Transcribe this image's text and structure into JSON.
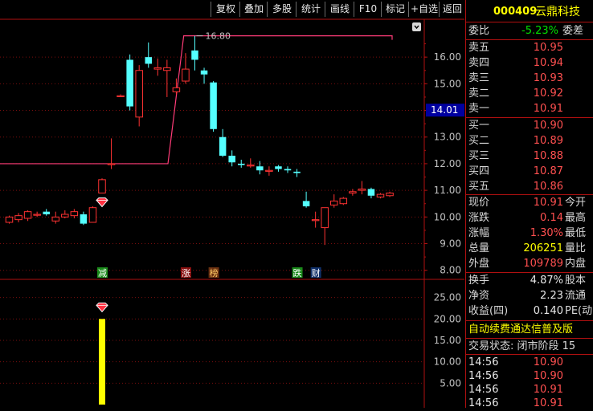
{
  "toolbar": {
    "buttons": [
      "复权",
      "叠加",
      "多股",
      "统计",
      "画线",
      "F10",
      "标记",
      "+自选",
      "返回"
    ]
  },
  "stock": {
    "code": "000409",
    "name": "云鼎科技"
  },
  "order_book": {
    "ratio_label": "委比",
    "ratio_value": "-5.23%",
    "diff_label": "委差",
    "asks": [
      {
        "label": "卖五",
        "price": "10.95"
      },
      {
        "label": "卖四",
        "price": "10.94"
      },
      {
        "label": "卖三",
        "price": "10.93"
      },
      {
        "label": "卖二",
        "price": "10.92"
      },
      {
        "label": "卖一",
        "price": "10.91"
      }
    ],
    "bids": [
      {
        "label": "买一",
        "price": "10.90"
      },
      {
        "label": "买二",
        "price": "10.89"
      },
      {
        "label": "买三",
        "price": "10.88"
      },
      {
        "label": "买四",
        "price": "10.87"
      },
      {
        "label": "买五",
        "price": "10.86"
      }
    ]
  },
  "quote": [
    {
      "label": "现价",
      "value": "10.91",
      "extra": "今开",
      "color": "#ff5050"
    },
    {
      "label": "涨跌",
      "value": "0.14",
      "extra": "最高",
      "color": "#ff5050"
    },
    {
      "label": "涨幅",
      "value": "1.30%",
      "extra": "最低",
      "color": "#ff5050"
    },
    {
      "label": "总量",
      "value": "206251",
      "extra": "量比",
      "color": "#ffff00"
    },
    {
      "label": "外盘",
      "value": "109789",
      "extra": "内盘",
      "color": "#ff5050"
    }
  ],
  "stats": [
    {
      "label": "换手",
      "value": "4.87%",
      "extra": "股本"
    },
    {
      "label": "净资",
      "value": "2.23",
      "extra": "流通"
    },
    {
      "label": "收益(四)",
      "value": "0.140",
      "extra": "PE(动"
    }
  ],
  "promo": "自动续费通达信普及版",
  "trade_status": "交易状态: 闭市阶段 15",
  "ticks": [
    {
      "time": "14:56",
      "price": "10.90"
    },
    {
      "time": "14:56",
      "price": "10.90"
    },
    {
      "time": "14:56",
      "price": "10.91"
    },
    {
      "time": "14:56",
      "price": "10.91"
    }
  ],
  "chart_data": {
    "type": "candlestick",
    "price_axis": {
      "ticks": [
        "16.00",
        "15.00",
        "14.00",
        "13.00",
        "12.00",
        "11.00",
        "10.00",
        "9.00",
        "8.00"
      ],
      "ylim": [
        7.75,
        17.3
      ]
    },
    "current_price_label": "14.01",
    "max_label": "16.80",
    "candles": [
      {
        "o": 9.8,
        "h": 10.05,
        "l": 9.75,
        "c": 10.0
      },
      {
        "o": 9.9,
        "h": 10.15,
        "l": 9.8,
        "c": 10.05
      },
      {
        "o": 9.95,
        "h": 10.25,
        "l": 9.85,
        "c": 10.2
      },
      {
        "o": 10.1,
        "h": 10.2,
        "l": 10.0,
        "c": 10.1
      },
      {
        "o": 10.2,
        "h": 10.3,
        "l": 10.05,
        "c": 10.1
      },
      {
        "o": 9.85,
        "h": 10.2,
        "l": 9.75,
        "c": 10.0
      },
      {
        "o": 10.0,
        "h": 10.25,
        "l": 9.95,
        "c": 10.1
      },
      {
        "o": 10.05,
        "h": 10.3,
        "l": 9.95,
        "c": 10.2
      },
      {
        "o": 10.1,
        "h": 10.2,
        "l": 9.7,
        "c": 9.75
      },
      {
        "o": 9.8,
        "h": 10.4,
        "l": 9.8,
        "c": 10.35
      },
      {
        "o": 10.9,
        "h": 11.45,
        "l": 10.9,
        "c": 11.4
      },
      {
        "o": 12.0,
        "h": 12.95,
        "l": 11.8,
        "c": 12.0
      },
      {
        "o": 14.55,
        "h": 14.6,
        "l": 14.5,
        "c": 14.55
      },
      {
        "o": 15.9,
        "h": 16.1,
        "l": 14.0,
        "c": 14.15
      },
      {
        "o": 13.75,
        "h": 15.7,
        "l": 13.4,
        "c": 15.5
      },
      {
        "o": 16.0,
        "h": 16.55,
        "l": 15.6,
        "c": 15.75
      },
      {
        "o": 15.55,
        "h": 15.95,
        "l": 15.3,
        "c": 15.6
      },
      {
        "o": 15.5,
        "h": 15.9,
        "l": 14.5,
        "c": 15.6
      },
      {
        "o": 14.7,
        "h": 15.2,
        "l": 14.6,
        "c": 14.85
      },
      {
        "o": 15.1,
        "h": 16.15,
        "l": 15.0,
        "c": 15.55
      },
      {
        "o": 16.25,
        "h": 16.8,
        "l": 15.5,
        "c": 15.9
      },
      {
        "o": 15.5,
        "h": 15.6,
        "l": 15.0,
        "c": 15.35
      },
      {
        "o": 15.05,
        "h": 15.1,
        "l": 13.2,
        "c": 13.3
      },
      {
        "o": 13.0,
        "h": 13.3,
        "l": 12.25,
        "c": 12.3
      },
      {
        "o": 12.3,
        "h": 12.5,
        "l": 11.9,
        "c": 12.05
      },
      {
        "o": 12.0,
        "h": 12.15,
        "l": 11.85,
        "c": 11.95
      },
      {
        "o": 11.95,
        "h": 12.2,
        "l": 11.85,
        "c": 11.95
      },
      {
        "o": 11.9,
        "h": 12.1,
        "l": 11.6,
        "c": 11.75
      },
      {
        "o": 11.75,
        "h": 11.9,
        "l": 11.55,
        "c": 11.75
      },
      {
        "o": 11.9,
        "h": 11.95,
        "l": 11.7,
        "c": 11.8
      },
      {
        "o": 11.8,
        "h": 11.9,
        "l": 11.65,
        "c": 11.75
      },
      {
        "o": 11.7,
        "h": 11.8,
        "l": 11.5,
        "c": 11.65
      },
      {
        "o": 10.6,
        "h": 10.95,
        "l": 10.35,
        "c": 10.4
      },
      {
        "o": 9.9,
        "h": 10.2,
        "l": 9.6,
        "c": 9.9
      },
      {
        "o": 9.6,
        "h": 10.35,
        "l": 8.95,
        "c": 10.35
      },
      {
        "o": 10.45,
        "h": 10.85,
        "l": 10.35,
        "c": 10.6
      },
      {
        "o": 10.5,
        "h": 10.75,
        "l": 10.45,
        "c": 10.7
      },
      {
        "o": 10.9,
        "h": 11.05,
        "l": 10.8,
        "c": 10.95
      },
      {
        "o": 11.0,
        "h": 11.35,
        "l": 10.85,
        "c": 11.05
      },
      {
        "o": 11.05,
        "h": 11.1,
        "l": 10.7,
        "c": 10.8
      },
      {
        "o": 10.75,
        "h": 10.9,
        "l": 10.7,
        "c": 10.85
      },
      {
        "o": 10.8,
        "h": 10.95,
        "l": 10.75,
        "c": 10.9
      }
    ],
    "markers": [
      {
        "index": 10,
        "label": "减",
        "bg": "#1a8a1a",
        "color": "#ffffff"
      },
      {
        "index": 19,
        "label": "涨",
        "bg": "#8a1010",
        "color": "#ffffff"
      },
      {
        "index": 22,
        "label": "榜",
        "bg": "#6a3010",
        "color": "#ffcc66"
      },
      {
        "index": 31,
        "label": "跌",
        "bg": "#1a8a1a",
        "color": "#ffffff"
      },
      {
        "index": 33,
        "label": "财",
        "bg": "#10306a",
        "color": "#ffffff"
      }
    ],
    "volume": {
      "ticks": [
        "25.00",
        "20.00",
        "15.00",
        "10.00",
        "5.00"
      ],
      "ylim": [
        0,
        28.5
      ],
      "bar": {
        "index": 10,
        "value": 20.0,
        "color": "#ffff00"
      }
    },
    "colors": {
      "up": "#ff3232",
      "down": "#54ffff",
      "grid": "#7a0e0e",
      "axis_text": "#c0c0c0",
      "line": "#ff3c78"
    }
  }
}
